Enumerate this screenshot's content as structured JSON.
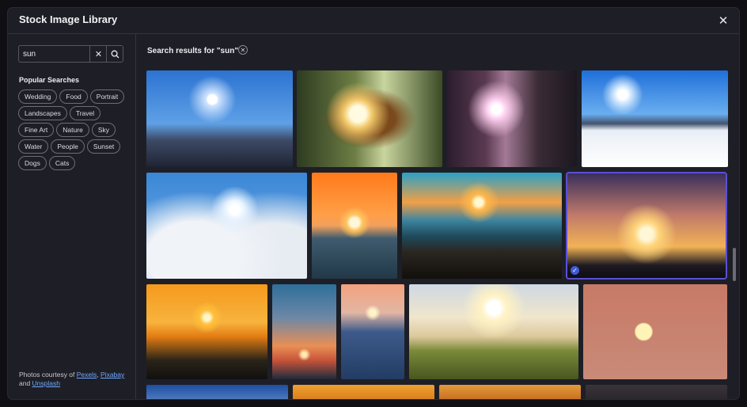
{
  "modal": {
    "title": "Stock Image Library",
    "close_icon": "close-icon"
  },
  "sidebar": {
    "search": {
      "value": "sun",
      "placeholder": "",
      "clear_icon": "close-icon",
      "submit_icon": "search-icon"
    },
    "popular_heading": "Popular Searches",
    "tags": [
      "Wedding",
      "Food",
      "Portrait",
      "Landscapes",
      "Travel",
      "Fine Art",
      "Nature",
      "Sky",
      "Water",
      "People",
      "Sunset",
      "Dogs",
      "Cats"
    ],
    "credits": {
      "prefix": "Photos courtesy of ",
      "sources": [
        "Pexels",
        "Pixabay",
        "Unsplash"
      ],
      "sep1": ", ",
      "sep2": " and "
    }
  },
  "main": {
    "results_heading": "Search results for \"sun\"",
    "clear_icon": "close-icon",
    "selected_index": 7,
    "images": [
      {
        "subject": "sun over mountains"
      },
      {
        "subject": "leaf against sun"
      },
      {
        "subject": "sun through forest"
      },
      {
        "subject": "sun over snowy road"
      },
      {
        "subject": "sun through clouds"
      },
      {
        "subject": "sunset over pier"
      },
      {
        "subject": "sunset over rocky coast"
      },
      {
        "subject": "silhouette at sunset"
      },
      {
        "subject": "orange sunset over hill"
      },
      {
        "subject": "sunset over sea"
      },
      {
        "subject": "sun over calm water"
      },
      {
        "subject": "sun over beach grass"
      },
      {
        "subject": "sun in pink sky"
      },
      {
        "subject": "blue sky"
      },
      {
        "subject": "orange sky"
      },
      {
        "subject": "sunset"
      },
      {
        "subject": "dark sky"
      }
    ]
  }
}
